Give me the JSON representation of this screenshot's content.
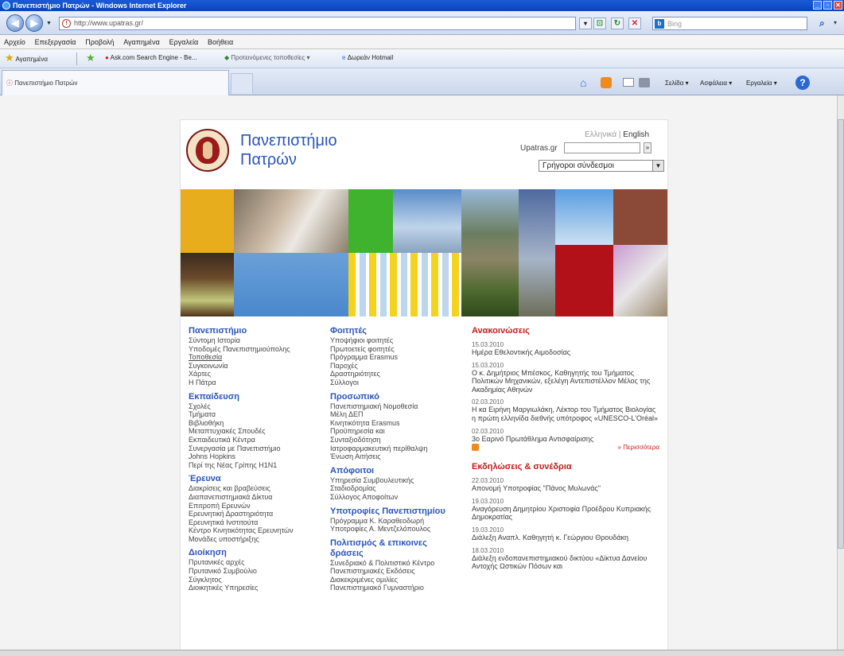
{
  "window": {
    "title": "Πανεπιστήμιο Πατρών - Windows Internet Explorer",
    "controls": [
      "_",
      "▫",
      "✕"
    ]
  },
  "address_bar": {
    "url": "http://www.upatras.gr/",
    "search_placeholder": "Bing"
  },
  "menu": [
    "Αρχείο",
    "Επεξεργασία",
    "Προβολή",
    "Αγαπημένα",
    "Εργαλεία",
    "Βοήθεια"
  ],
  "favorites_bar": {
    "favorites_label": "Αγαπημένα",
    "items": [
      "Ask.com Search Engine - Be...",
      "Προτεινόμενες τοποθεσίες ▾",
      "Δωρεάν Hotmail"
    ]
  },
  "tabs": [
    {
      "label": "Πανεπιστήμιο Πατρών"
    }
  ],
  "command_bar": {
    "page": "Σελίδα ▾",
    "safety": "Ασφάλεια ▾",
    "tools": "Εργαλεία ▾"
  },
  "site": {
    "name_line1": "Πανεπιστήμιο",
    "name_line2": "Πατρών",
    "lang_el": "Ελληνικά",
    "lang_sep": "|",
    "lang_en": "English",
    "search_label": "Upatras.gr",
    "quick_links": "Γρήγοροι σύνδεσμοι"
  },
  "col1": [
    {
      "heading": "Πανεπιστήμιο",
      "links": [
        "Σύντομη Ιστορία",
        "Υποδομές Πανεπιστημιούπολης",
        "Τοποθεσία",
        "Συγκοινωνία",
        "Χάρτες",
        "Η Πάτρα"
      ]
    },
    {
      "heading": "Εκπαίδευση",
      "links": [
        "Σχολές",
        "Τμήματα",
        "Βιβλιοθήκη",
        "Μεταπτυχιακές Σπουδές",
        "Εκπαιδευτικά Κέντρα",
        "Συνεργασία με Πανεπιστήμιο",
        "Johns Hopkins",
        "Περί της Νέας Γρίπης Η1Ν1"
      ]
    },
    {
      "heading": "Έρευνα",
      "links": [
        "Διακρίσεις και βραβεύσεις",
        "Διαπανεπιστημιακά Δίκτυα",
        "Επιτροπή Ερευνών",
        "Ερευνητική Δραστηριότητα",
        "Ερευνητικά Ινστιτούτα",
        "Κέντρο Κινητικότητας Ερευνητών",
        "Μονάδες υποστήριξης"
      ]
    },
    {
      "heading": "Διοίκηση",
      "links": [
        "Πρυτανικές αρχές",
        "Πρυτανικό Συμβούλιο",
        "Σύγκλητος",
        "Διοικητικές Υπηρεσίες"
      ]
    }
  ],
  "col2": [
    {
      "heading": "Φοιτητές",
      "links": [
        "Υποψήφιοι φοιτητές",
        "Πρωτοετείς φοιτητές",
        "Πρόγραμμα Erasmus",
        "Παροχές",
        "Δραστηριότητες",
        "Σύλλογοι"
      ]
    },
    {
      "heading": "Προσωπικό",
      "links": [
        "Πανεπιστημιακή Νομοθεσία",
        "Μέλη ΔΕΠ",
        "Κινητικότητα Erasmus",
        "Προϋπηρεσία και",
        "Συνταξιοδότηση",
        "Ιατροφαρμακευτική περίθαλψη",
        "Ένωση Αιτήσεις"
      ]
    },
    {
      "heading": "Απόφοιτοι",
      "links": [
        "Υπηρεσία Συμβουλευτικής",
        "Σταδιοδρομίας",
        "Σύλλογος Αποφοίτων"
      ]
    },
    {
      "heading": "Υποτροφίες Πανεπιστημίου",
      "links": [
        "Πρόγραμμα Κ. Καραθεοδωρή",
        "Υποτροφίες Α. Μεντζελόπουλος"
      ]
    },
    {
      "heading": "Πολιτισμός & επικοινες δράσεις",
      "links": [
        "Συνεδριακό & Πολιτιστικό Κέντρο",
        "Πανεπιστημιακές Εκδόσεις",
        "Διακεκριμένες ομιλίες",
        "Πανεπιστημιακό Γυμναστήριο"
      ]
    }
  ],
  "announcements": {
    "heading": "Ανακοινώσεις",
    "items": [
      {
        "date": "15.03.2010",
        "text": "Ημέρα Εθελοντικής Αιμοδοσίας"
      },
      {
        "date": "15.03.2010",
        "text": "Ο κ. Δημήτριος Μπέσκος, Καθηγητής του Τμήματος Πολιτικών Μηχανικών, εξελέγη Αντεπιστέλλον Μέλος της Ακαδημίας Αθηνών"
      },
      {
        "date": "02.03.2010",
        "text": "Η κα Ειρήνη Μαργιωλάκη, Λέκτορ του Τμήματος Βιολογίας η πρώτη ελληνίδα διεθνής υπότροφος «UNESCO-L'Oréal»"
      },
      {
        "date": "02.03.2010",
        "text": "3ο Εαρινό Πρωτάθλημα Αντισφαίρισης"
      }
    ],
    "more": "» Περισσότερα"
  },
  "events": {
    "heading": "Εκδηλώσεις & συνέδρια",
    "items": [
      {
        "date": "22.03.2010",
        "text": "Απονομή Υποτροφίας \"Πάνος Μυλωνάς\""
      },
      {
        "date": "19.03.2010",
        "text": "Αναγόρευση Δημητρίου Χριστοφία Προέδρου Κυπριακής Δημοκρατίας"
      },
      {
        "date": "19.03.2010",
        "text": "Διάλεξη Αναπλ. Καθηγητή κ. Γεώργιου Θρουδάκη"
      },
      {
        "date": "18.03.2010",
        "text": "Διάλεξη ενδοπανεπιστημιακού δικτύου «Δίκτυα Δανείου Αντοχής Ωστικών Πόσων και"
      }
    ]
  }
}
